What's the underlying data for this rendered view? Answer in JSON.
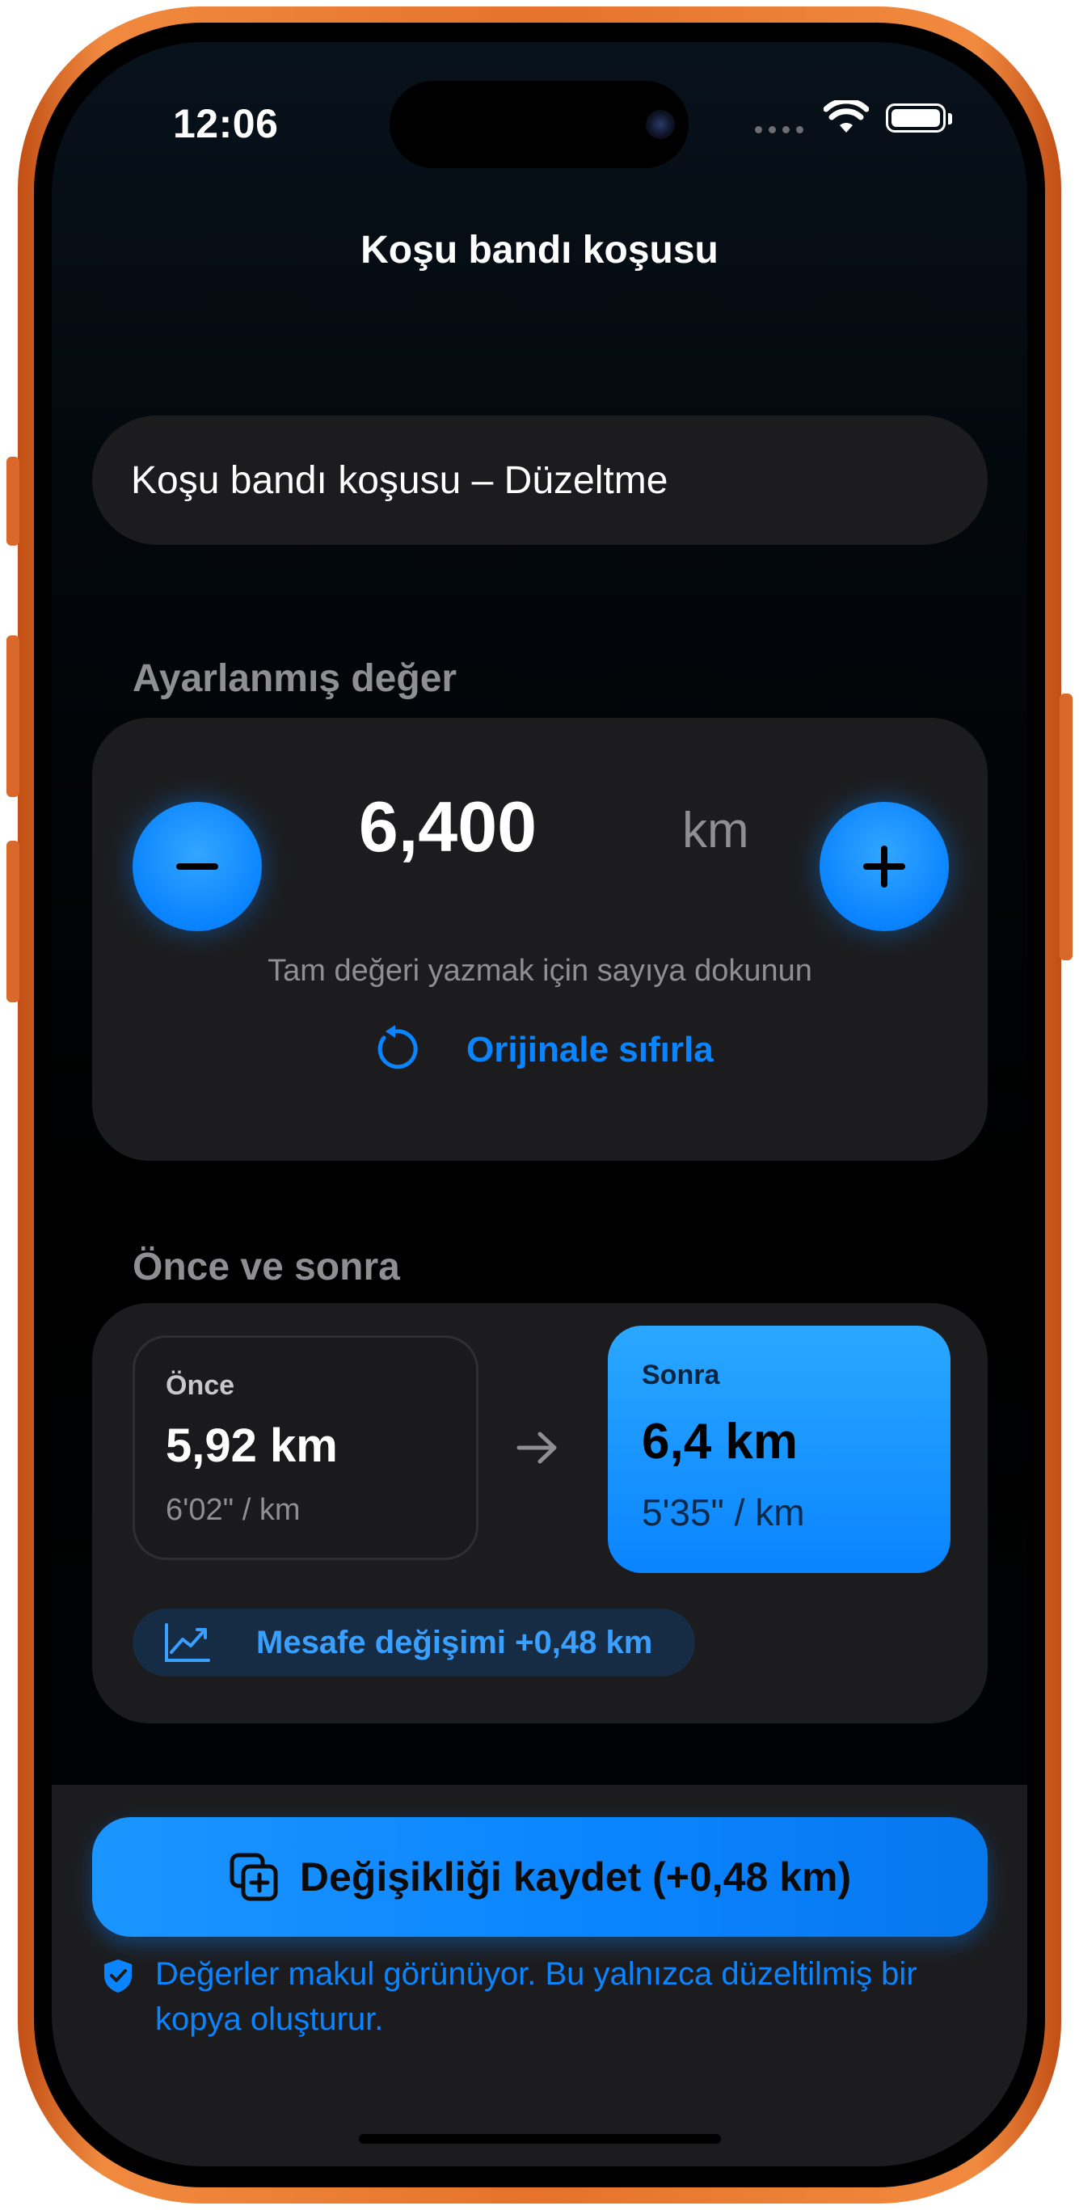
{
  "status_bar": {
    "time": "12:06"
  },
  "nav": {
    "title": "Koşu bandı koşusu"
  },
  "name_field": {
    "value": "Koşu bandı koşusu – Düzeltme"
  },
  "adjusted": {
    "header": "Ayarlanmış değer",
    "value": "6,400",
    "unit": "km",
    "hint": "Tam değeri yazmak için sayıya dokunun",
    "reset_label": "Orijinale sıfırla"
  },
  "comparison": {
    "header": "Önce ve sonra",
    "before": {
      "label": "Önce",
      "value": "5,92 km",
      "pace": "6'02\" / km"
    },
    "after": {
      "label": "Sonra",
      "value": "6,4 km",
      "pace": "5'35\" / km"
    },
    "change_label": "Mesafe değişimi +0,48 km"
  },
  "footer": {
    "save_label": "Değişikliği kaydet (+0,48 km)",
    "note": "Değerler makul görünüyor. Bu yalnızca düzeltilmiş bir kopya oluşturur."
  },
  "colors": {
    "accent": "#0a84ff",
    "frame": "#e6722b",
    "card": "#1c1c1e",
    "secondary_text": "#8e8e93"
  },
  "icons": [
    "minus-icon",
    "plus-icon",
    "reset-icon",
    "arrow-right-icon",
    "chart-icon",
    "duplicate-add-icon",
    "shield-check-icon",
    "wifi-icon",
    "battery-icon"
  ]
}
